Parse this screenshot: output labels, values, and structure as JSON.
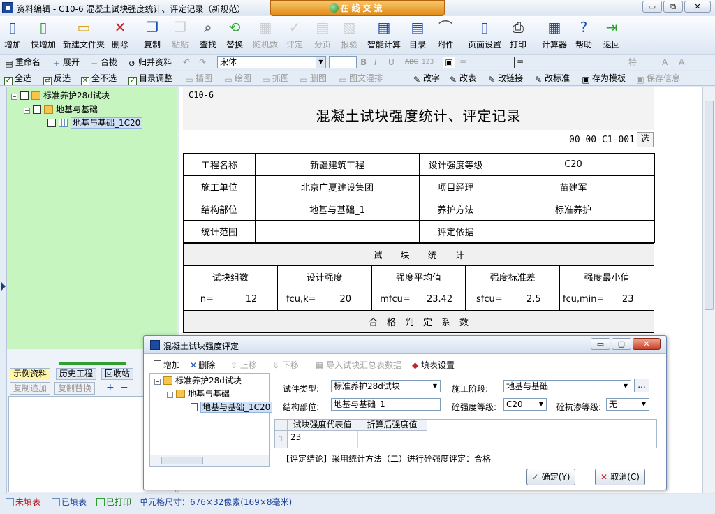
{
  "window": {
    "title": "资料编辑 - C10-6 混凝土试块强度统计、评定记录（新规范）",
    "online": "在线交流",
    "min": "▭",
    "max": "⧉",
    "close": "✕"
  },
  "toolbar1": [
    {
      "label": "增加",
      "icon": "▯",
      "enabled": true
    },
    {
      "label": "快增加",
      "icon": "▯",
      "enabled": true
    },
    {
      "label": "新建文件夹",
      "icon": "▭",
      "enabled": true
    },
    {
      "label": "删除",
      "icon": "✕",
      "enabled": true
    },
    {
      "label": "复制",
      "icon": "❐",
      "enabled": true
    },
    {
      "label": "粘贴",
      "icon": "❐",
      "enabled": false
    },
    {
      "label": "查找",
      "icon": "⌕",
      "enabled": true
    },
    {
      "label": "替换",
      "icon": "⟲",
      "enabled": true
    },
    {
      "label": "随机数",
      "icon": "▦",
      "enabled": false
    },
    {
      "label": "评定",
      "icon": "✓",
      "enabled": false
    },
    {
      "label": "分页",
      "icon": "▤",
      "enabled": false
    },
    {
      "label": "报验",
      "icon": "▧",
      "enabled": false
    },
    {
      "label": "智能计算",
      "icon": "▦",
      "enabled": true
    },
    {
      "label": "目录",
      "icon": "▤",
      "enabled": true
    },
    {
      "label": "附件",
      "icon": "⌒",
      "enabled": true
    },
    {
      "label": "页面设置",
      "icon": "▯",
      "enabled": true
    },
    {
      "label": "打印",
      "icon": "⎙",
      "enabled": true
    },
    {
      "label": "计算器",
      "icon": "▦",
      "enabled": true
    },
    {
      "label": "帮助",
      "icon": "?",
      "enabled": true
    },
    {
      "label": "返回",
      "icon": "⇥",
      "enabled": true
    }
  ],
  "toolbar2": {
    "rename": "重命名",
    "expand": "展开",
    "collapse": "合拢",
    "merge": "归并资料",
    "font": "宋体",
    "strike": "ABC",
    "num": "123",
    "special": "特"
  },
  "toolbar3": {
    "select_all": "全选",
    "invert": "反选",
    "select_none": "全不选",
    "dir_adjust": "目录调整",
    "insert_pic": "插图",
    "draw": "绘图",
    "grab": "抓图",
    "del_pic": "删图",
    "pic_text": "图文混排",
    "change_char": "改字",
    "change_table": "改表",
    "change_link": "改链接",
    "change_std": "改标准",
    "save_tpl": "存为模板",
    "save_info": "保存信息"
  },
  "tree": {
    "root": "标准养护28d试块",
    "child": "地基与基础",
    "leaf": "地基与基础_1C20"
  },
  "left_tabs": [
    "示例资料",
    "历史工程",
    "回收站"
  ],
  "left_btns": [
    "复制追加",
    "复制替换"
  ],
  "doc": {
    "code": "C10-6",
    "title": "混凝土试块强度统计、评定记录",
    "number": "00-00-C1-001",
    "select_btn": "选",
    "rows": [
      {
        "l1": "工程名称",
        "v1": "新疆建筑工程",
        "l2": "设计强度等级",
        "v2": "C20"
      },
      {
        "l1": "施工单位",
        "v1": "北京广夏建设集团",
        "l2": "项目经理",
        "v2": "苗建军"
      },
      {
        "l1": "结构部位",
        "v1": "地基与基础_1",
        "l2": "养护方法",
        "v2": "标准养护"
      },
      {
        "l1": "统计范围",
        "v1": "",
        "l2": "评定依据",
        "v2": ""
      }
    ],
    "section1": "试　　块　　统　　计",
    "stat_heads": [
      "试块组数",
      "设计强度",
      "强度平均值",
      "强度标准差",
      "强度最小值"
    ],
    "stat_labels": [
      "n=",
      "fcu,k=",
      "mfcu=",
      "sfcu=",
      "fcu,min="
    ],
    "stat_values": [
      "12",
      "20",
      "23.42",
      "2.5",
      "23"
    ],
    "section2": "合　格　判　定　系　数"
  },
  "status": {
    "unfilled": "未填表",
    "filled": "已填表",
    "printed": "已打印",
    "cell_size": "单元格尺寸：676×32像素(169×8毫米)"
  },
  "dialog": {
    "title": "混凝土试块强度评定",
    "tb_add": "增加",
    "tb_delete": "删除",
    "tb_up": "上移",
    "tb_down": "下移",
    "tb_import": "导入试块汇总表数据",
    "tb_fill": "填表设置",
    "tree_root": "标准养护28d试块",
    "tree_child": "地基与基础",
    "tree_leaf": "地基与基础_1C20",
    "specimen_type_label": "试件类型:",
    "specimen_type": "标准养护28d试块",
    "stage_label": "施工阶段:",
    "stage": "地基与基础",
    "more": "...",
    "struct_label": "结构部位:",
    "struct": "地基与基础_1",
    "grade_label": "砼强度等级:",
    "grade": "C20",
    "seep_label": "砼抗渗等级:",
    "seep": "无",
    "grid_head1": "试块强度代表值",
    "grid_head2": "折算后强度值",
    "grid_row_num": "1",
    "grid_val": "23",
    "conclusion": "【评定结论】采用统计方法（二）进行砼强度评定：合格",
    "ok": "确定(Y)",
    "cancel": "取消(C)"
  }
}
